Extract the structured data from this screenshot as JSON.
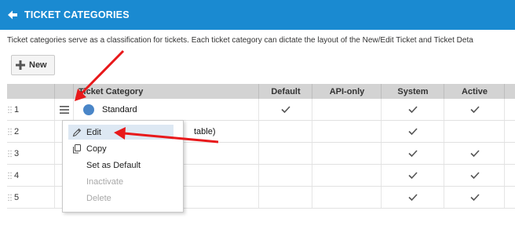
{
  "header": {
    "title": "TICKET CATEGORIES"
  },
  "description": "Ticket categories serve as a classification for tickets. Each ticket category can dictate the layout of the New/Edit Ticket and Ticket Deta",
  "toolbar": {
    "new_label": "New"
  },
  "grid": {
    "columns": [
      "Ticket Category",
      "Default",
      "API-only",
      "System",
      "Active"
    ],
    "rows": [
      {
        "num": "1",
        "name": "Standard",
        "default": true,
        "api_only": false,
        "system": true,
        "active": true
      },
      {
        "num": "2",
        "name": "table)",
        "default": false,
        "api_only": false,
        "system": true,
        "active": false
      },
      {
        "num": "3",
        "name": "",
        "default": false,
        "api_only": false,
        "system": true,
        "active": true
      },
      {
        "num": "4",
        "name": "",
        "default": false,
        "api_only": false,
        "system": true,
        "active": true
      },
      {
        "num": "5",
        "name": "",
        "default": false,
        "api_only": false,
        "system": true,
        "active": true
      }
    ]
  },
  "context_menu": {
    "items": [
      {
        "label": "Edit",
        "icon": "pencil-icon",
        "state": "hover"
      },
      {
        "label": "Copy",
        "icon": "copy-icon",
        "state": "enabled"
      },
      {
        "label": "Set as Default",
        "icon": "",
        "state": "enabled"
      },
      {
        "label": "Inactivate",
        "icon": "",
        "state": "disabled"
      },
      {
        "label": "Delete",
        "icon": "",
        "state": "disabled"
      }
    ]
  },
  "colors": {
    "header_bg": "#1a8ad1",
    "annotation_arrow": "#e8191b",
    "category_dot": "#4a86c8"
  }
}
